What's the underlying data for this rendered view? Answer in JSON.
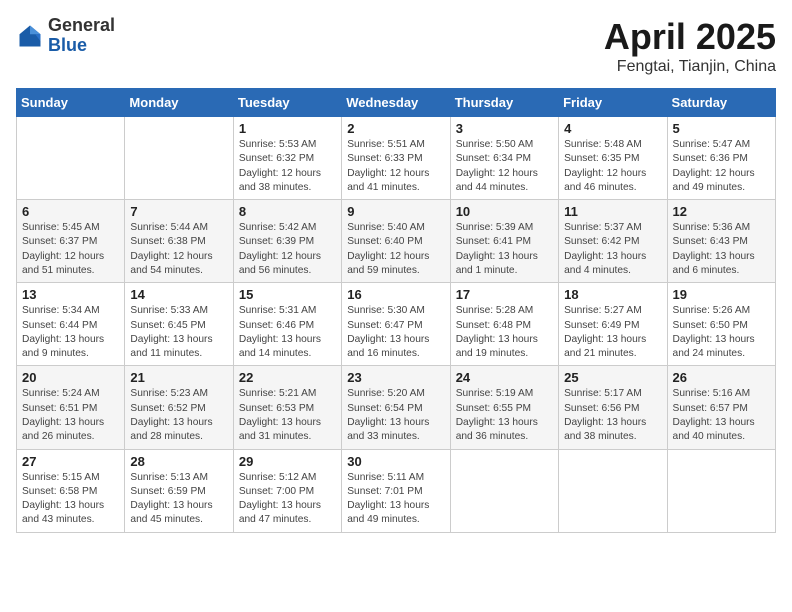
{
  "logo": {
    "general": "General",
    "blue": "Blue"
  },
  "header": {
    "title": "April 2025",
    "subtitle": "Fengtai, Tianjin, China"
  },
  "weekdays": [
    "Sunday",
    "Monday",
    "Tuesday",
    "Wednesday",
    "Thursday",
    "Friday",
    "Saturday"
  ],
  "weeks": [
    [
      {
        "day": "",
        "content": ""
      },
      {
        "day": "",
        "content": ""
      },
      {
        "day": "1",
        "content": "Sunrise: 5:53 AM\nSunset: 6:32 PM\nDaylight: 12 hours and 38 minutes."
      },
      {
        "day": "2",
        "content": "Sunrise: 5:51 AM\nSunset: 6:33 PM\nDaylight: 12 hours and 41 minutes."
      },
      {
        "day": "3",
        "content": "Sunrise: 5:50 AM\nSunset: 6:34 PM\nDaylight: 12 hours and 44 minutes."
      },
      {
        "day": "4",
        "content": "Sunrise: 5:48 AM\nSunset: 6:35 PM\nDaylight: 12 hours and 46 minutes."
      },
      {
        "day": "5",
        "content": "Sunrise: 5:47 AM\nSunset: 6:36 PM\nDaylight: 12 hours and 49 minutes."
      }
    ],
    [
      {
        "day": "6",
        "content": "Sunrise: 5:45 AM\nSunset: 6:37 PM\nDaylight: 12 hours and 51 minutes."
      },
      {
        "day": "7",
        "content": "Sunrise: 5:44 AM\nSunset: 6:38 PM\nDaylight: 12 hours and 54 minutes."
      },
      {
        "day": "8",
        "content": "Sunrise: 5:42 AM\nSunset: 6:39 PM\nDaylight: 12 hours and 56 minutes."
      },
      {
        "day": "9",
        "content": "Sunrise: 5:40 AM\nSunset: 6:40 PM\nDaylight: 12 hours and 59 minutes."
      },
      {
        "day": "10",
        "content": "Sunrise: 5:39 AM\nSunset: 6:41 PM\nDaylight: 13 hours and 1 minute."
      },
      {
        "day": "11",
        "content": "Sunrise: 5:37 AM\nSunset: 6:42 PM\nDaylight: 13 hours and 4 minutes."
      },
      {
        "day": "12",
        "content": "Sunrise: 5:36 AM\nSunset: 6:43 PM\nDaylight: 13 hours and 6 minutes."
      }
    ],
    [
      {
        "day": "13",
        "content": "Sunrise: 5:34 AM\nSunset: 6:44 PM\nDaylight: 13 hours and 9 minutes."
      },
      {
        "day": "14",
        "content": "Sunrise: 5:33 AM\nSunset: 6:45 PM\nDaylight: 13 hours and 11 minutes."
      },
      {
        "day": "15",
        "content": "Sunrise: 5:31 AM\nSunset: 6:46 PM\nDaylight: 13 hours and 14 minutes."
      },
      {
        "day": "16",
        "content": "Sunrise: 5:30 AM\nSunset: 6:47 PM\nDaylight: 13 hours and 16 minutes."
      },
      {
        "day": "17",
        "content": "Sunrise: 5:28 AM\nSunset: 6:48 PM\nDaylight: 13 hours and 19 minutes."
      },
      {
        "day": "18",
        "content": "Sunrise: 5:27 AM\nSunset: 6:49 PM\nDaylight: 13 hours and 21 minutes."
      },
      {
        "day": "19",
        "content": "Sunrise: 5:26 AM\nSunset: 6:50 PM\nDaylight: 13 hours and 24 minutes."
      }
    ],
    [
      {
        "day": "20",
        "content": "Sunrise: 5:24 AM\nSunset: 6:51 PM\nDaylight: 13 hours and 26 minutes."
      },
      {
        "day": "21",
        "content": "Sunrise: 5:23 AM\nSunset: 6:52 PM\nDaylight: 13 hours and 28 minutes."
      },
      {
        "day": "22",
        "content": "Sunrise: 5:21 AM\nSunset: 6:53 PM\nDaylight: 13 hours and 31 minutes."
      },
      {
        "day": "23",
        "content": "Sunrise: 5:20 AM\nSunset: 6:54 PM\nDaylight: 13 hours and 33 minutes."
      },
      {
        "day": "24",
        "content": "Sunrise: 5:19 AM\nSunset: 6:55 PM\nDaylight: 13 hours and 36 minutes."
      },
      {
        "day": "25",
        "content": "Sunrise: 5:17 AM\nSunset: 6:56 PM\nDaylight: 13 hours and 38 minutes."
      },
      {
        "day": "26",
        "content": "Sunrise: 5:16 AM\nSunset: 6:57 PM\nDaylight: 13 hours and 40 minutes."
      }
    ],
    [
      {
        "day": "27",
        "content": "Sunrise: 5:15 AM\nSunset: 6:58 PM\nDaylight: 13 hours and 43 minutes."
      },
      {
        "day": "28",
        "content": "Sunrise: 5:13 AM\nSunset: 6:59 PM\nDaylight: 13 hours and 45 minutes."
      },
      {
        "day": "29",
        "content": "Sunrise: 5:12 AM\nSunset: 7:00 PM\nDaylight: 13 hours and 47 minutes."
      },
      {
        "day": "30",
        "content": "Sunrise: 5:11 AM\nSunset: 7:01 PM\nDaylight: 13 hours and 49 minutes."
      },
      {
        "day": "",
        "content": ""
      },
      {
        "day": "",
        "content": ""
      },
      {
        "day": "",
        "content": ""
      }
    ]
  ]
}
